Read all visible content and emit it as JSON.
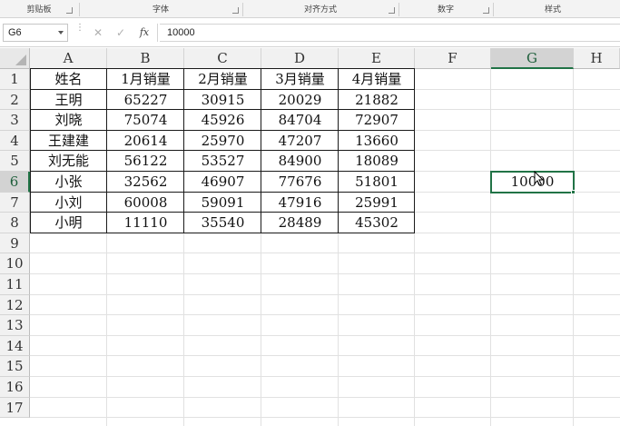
{
  "ribbon": {
    "groups": [
      {
        "label": "剪贴板"
      },
      {
        "label": "字体"
      },
      {
        "label": "对齐方式"
      },
      {
        "label": "数字"
      },
      {
        "label": "样式"
      }
    ]
  },
  "formula_bar": {
    "name_box": "G6",
    "formula": "10000",
    "fx_label": "fx",
    "cancel_icon": "✕",
    "enter_icon": "✓"
  },
  "columns": [
    "A",
    "B",
    "C",
    "D",
    "E",
    "F",
    "G",
    "H"
  ],
  "rows": [
    "1",
    "2",
    "3",
    "4",
    "5",
    "6",
    "7",
    "8",
    "9",
    "10",
    "11",
    "12",
    "13",
    "14",
    "15",
    "16",
    "17"
  ],
  "table": {
    "headers": [
      "姓名",
      "1月销量",
      "2月销量",
      "3月销量",
      "4月销量"
    ],
    "rows": [
      [
        "王明",
        "65227",
        "30915",
        "20029",
        "21882"
      ],
      [
        "刘晓",
        "75074",
        "45926",
        "84704",
        "72907"
      ],
      [
        "王建建",
        "20614",
        "25970",
        "47207",
        "13660"
      ],
      [
        "刘无能",
        "56122",
        "53527",
        "84900",
        "18089"
      ],
      [
        "小张",
        "32562",
        "46907",
        "77676",
        "51801"
      ],
      [
        "小刘",
        "60008",
        "59091",
        "47916",
        "25991"
      ],
      [
        "小明",
        "11110",
        "35540",
        "28489",
        "45302"
      ]
    ]
  },
  "active_cell": {
    "ref": "G6",
    "value": "10000"
  },
  "colors": {
    "accent": "#217346",
    "grid": "#e1e1e1",
    "header_bg": "#f1f1f1"
  }
}
